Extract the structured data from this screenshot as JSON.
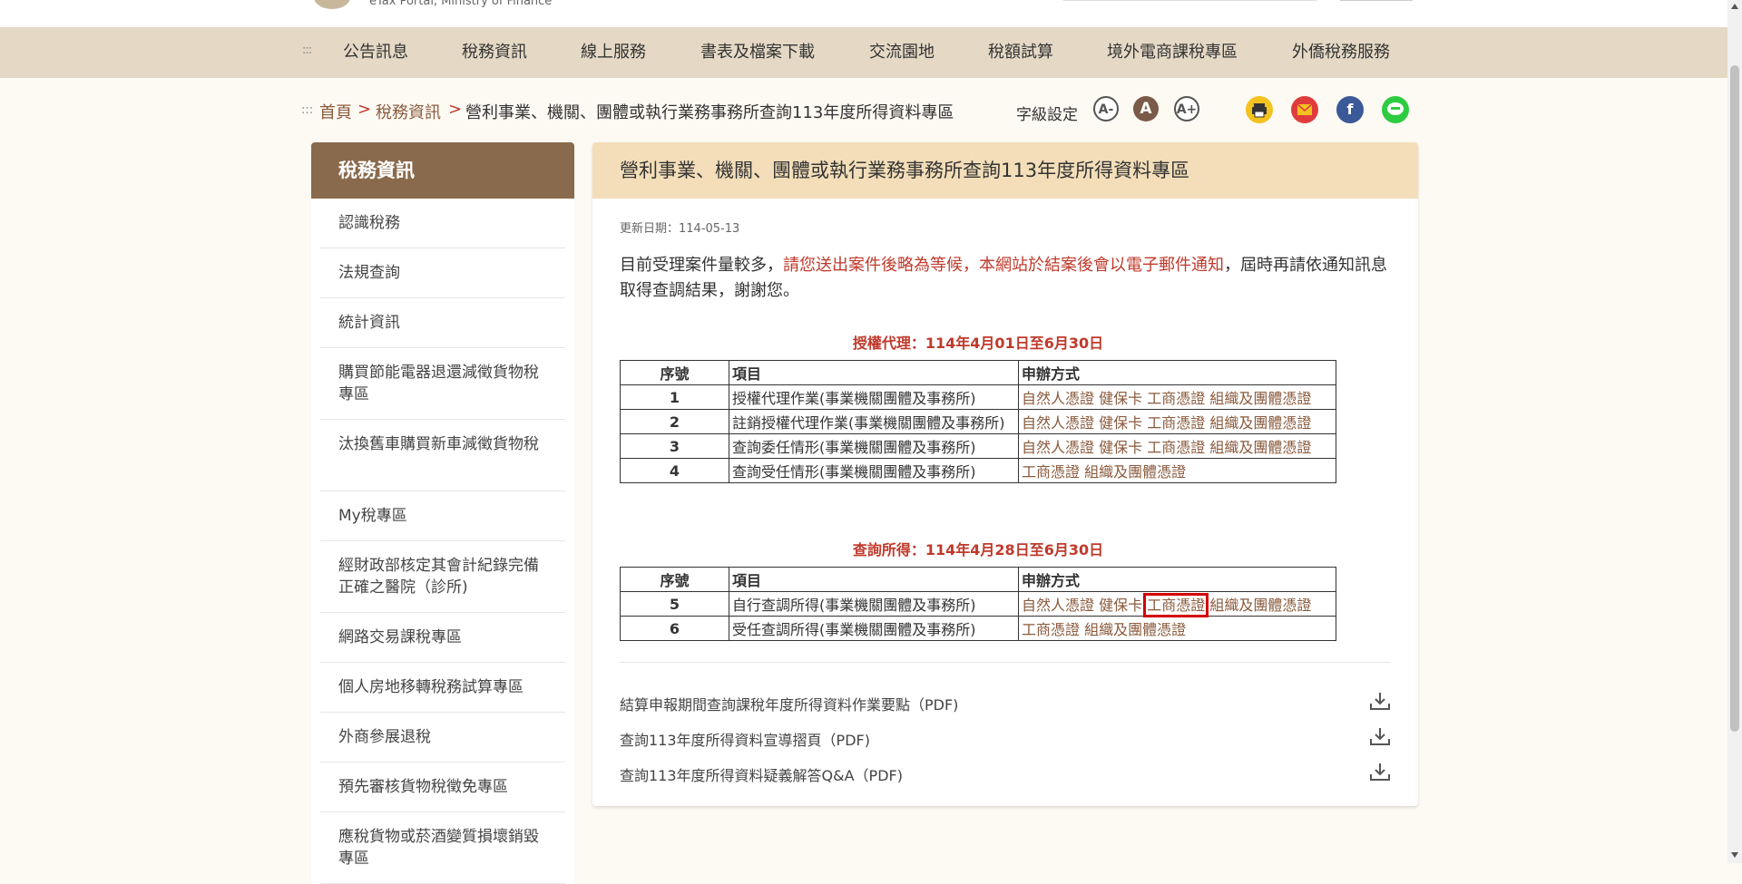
{
  "site": {
    "subtitle": "eTax Portal, Ministry of Finance"
  },
  "nav": {
    "items": [
      "公告訊息",
      "稅務資訊",
      "線上服務",
      "書表及檔案下載",
      "交流園地",
      "稅額試算",
      "境外電商課稅專區",
      "外僑稅務服務"
    ]
  },
  "breadcrumb": {
    "home": "首頁",
    "section": "稅務資訊",
    "current": "營利事業、機關、團體或執行業務事務所查詢113年度所得資料專區",
    "separator": ">"
  },
  "font_setting": {
    "label": "字級設定",
    "small": "A-",
    "normal": "A",
    "large": "A+"
  },
  "sidebar": {
    "title": "稅務資訊",
    "items": [
      "認識稅務",
      "法規查詢",
      "統計資訊",
      "購買節能電器退還減徵貨物稅專區",
      "汰換舊車購買新車減徵貨物稅",
      "My稅專區",
      "經財政部核定其會計紀錄完備正確之醫院（診所)",
      "網路交易課稅專區",
      "個人房地移轉稅務試算專區",
      "外商參展退稅",
      "預先審核貨物稅徵免專區",
      "應稅貨物或菸酒變質損壞銷毀專區"
    ]
  },
  "main": {
    "title": "營利事業、機關、團體或執行業務事務所查詢113年度所得資料專區",
    "update": "更新日期：114-05-13",
    "notice_prefix": "目前受理案件量較多，",
    "notice_red": "請您送出案件後略為等候，本網站於結案後會以電子郵件通知",
    "notice_suffix": "，屆時再請依通知訊息取得查調結果，謝謝您。",
    "table1_title": "授權代理：114年4月01日至6月30日",
    "table2_title": "查詢所得：114年4月28日至6月30日",
    "headers": {
      "no": "序號",
      "item": "項目",
      "method": "申辦方式"
    },
    "methods": {
      "natural": "自然人憑證",
      "health": "健保卡",
      "business": "工商憑證",
      "org": "組織及團體憑證"
    },
    "table1_rows": [
      {
        "no": "1",
        "item": "授權代理作業(事業機關團體及事務所)"
      },
      {
        "no": "2",
        "item": "註銷授權代理作業(事業機關團體及事務所)"
      },
      {
        "no": "3",
        "item": "查詢委任情形(事業機關團體及事務所)"
      },
      {
        "no": "4",
        "item": "查詢受任情形(事業機關團體及事務所)"
      }
    ],
    "table2_rows": [
      {
        "no": "5",
        "item": "自行查調所得(事業機關團體及事務所)"
      },
      {
        "no": "6",
        "item": "受任查調所得(事業機關團體及事務所)"
      }
    ],
    "downloads": [
      "結算申報期間查詢課稅年度所得資料作業要點（PDF)",
      "查詢113年度所得資料宣導摺頁（PDF)",
      "查詢113年度所得資料疑義解答Q&A（PDF)"
    ]
  },
  "colors": {
    "nav_bg": "#e5d9c5",
    "sidebar_head": "#8a6a4c",
    "main_head": "#f3deb9",
    "accent_red": "#c0392b",
    "link": "#8a5a3c",
    "highlight": "#d40000"
  }
}
